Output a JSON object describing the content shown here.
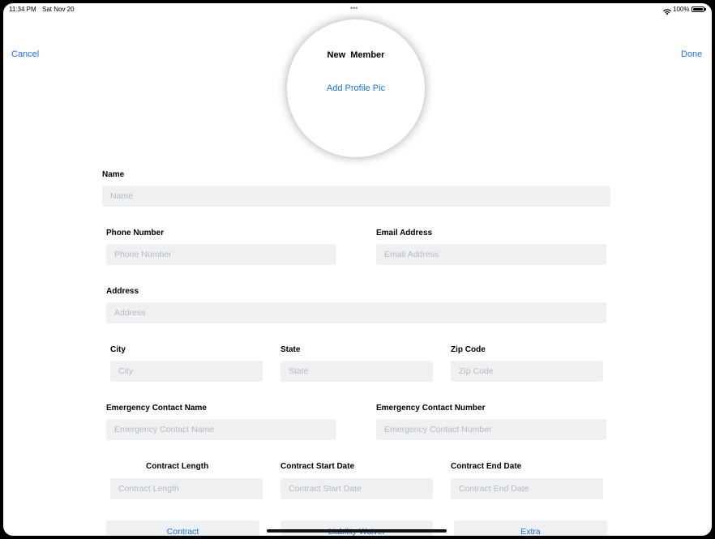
{
  "status_bar": {
    "time": "11:34 PM",
    "date": "Sat Nov 20",
    "multitask_dots": "•••",
    "battery": "100%"
  },
  "nav": {
    "cancel": "Cancel",
    "title": "New  Member",
    "add_pic": "Add Profile Pic",
    "done": "Done"
  },
  "form": {
    "name_label": "Name",
    "name_placeholder": "Name",
    "phone_label": "Phone Number",
    "phone_placeholder": "Phone Number",
    "email_label": "Email Address",
    "email_placeholder": "Email Address",
    "address_label": "Address",
    "address_placeholder": "Address",
    "city_label": "City",
    "city_placeholder": "City",
    "state_label": "State",
    "state_placeholder": "State",
    "zip_label": "Zip Code",
    "zip_placeholder": "Zip Code",
    "ec_name_label": "Emergency Contact Name",
    "ec_name_placeholder": "Emergency Contact Name",
    "ec_number_label": "Emergency Contact Number",
    "ec_number_placeholder": "Emergency Contact Number",
    "contract_length_label": "Contract Length",
    "contract_length_placeholder": "Contract Length",
    "contract_start_label": "Contract Start Date",
    "contract_start_placeholder": "Contract Start Date",
    "contract_end_label": "Contract End Date",
    "contract_end_placeholder": "Contract End Date"
  },
  "buttons": {
    "contract": "Contract",
    "liability": "Liability Waiver",
    "extra": "Extra"
  }
}
